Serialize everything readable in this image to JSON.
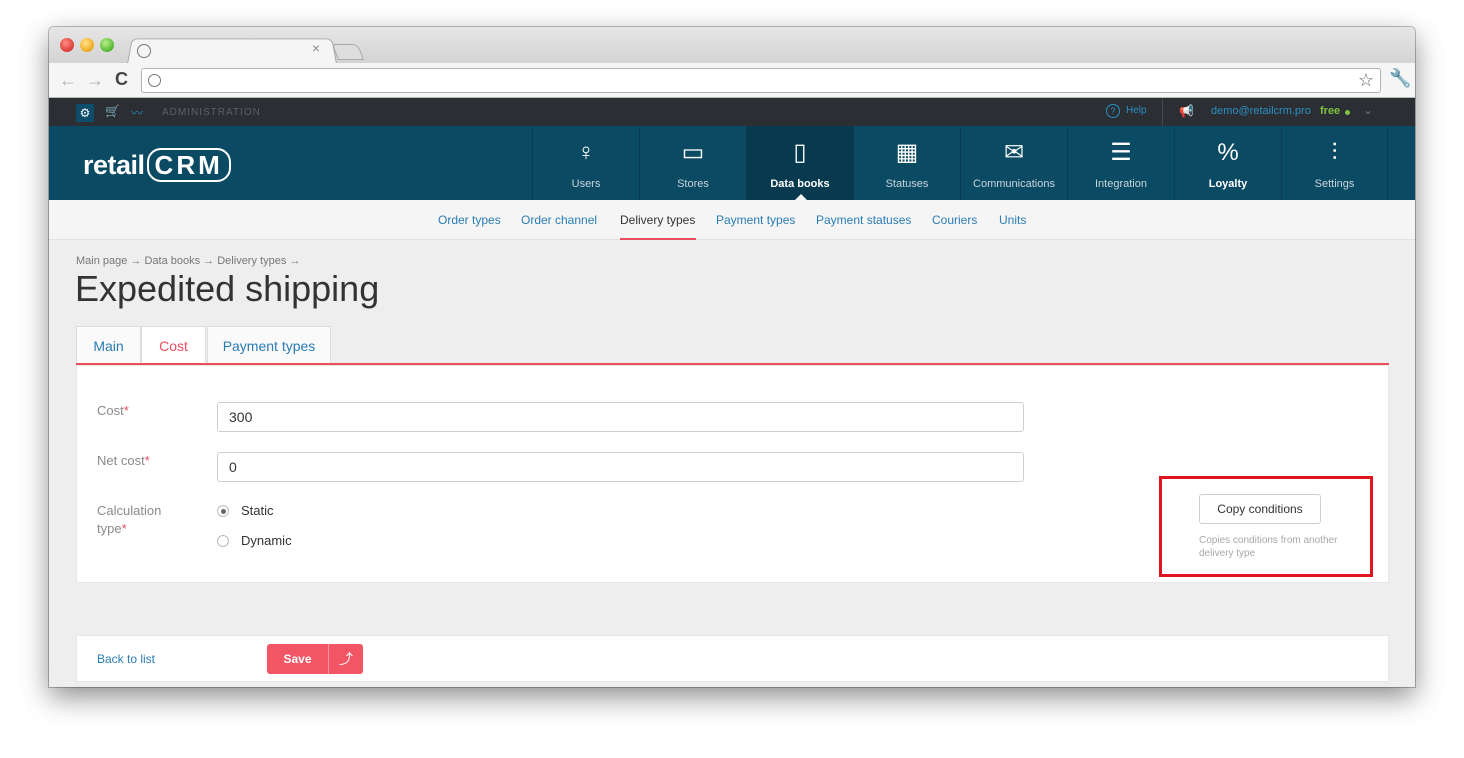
{
  "browser": {
    "tab_close": "×",
    "back_icon": "left-arrow",
    "forward_icon": "right-arrow"
  },
  "topbar": {
    "section_label": "ADMINISTRATION",
    "help": "Help",
    "email": "demo@retailcrm.pro",
    "plan": "free"
  },
  "logo": {
    "text_a": "retail",
    "text_b": "CRM"
  },
  "nav": [
    {
      "label": "Users",
      "icon": "user-icon",
      "glyph": "♀"
    },
    {
      "label": "Stores",
      "icon": "store-icon",
      "glyph": "▭"
    },
    {
      "label": "Data books",
      "icon": "book-icon",
      "glyph": "▯"
    },
    {
      "label": "Statuses",
      "icon": "statuses-icon",
      "glyph": "▦"
    },
    {
      "label": "Communications",
      "icon": "mail-icon",
      "glyph": "✉"
    },
    {
      "label": "Integration",
      "icon": "integration-icon",
      "glyph": "☰"
    },
    {
      "label": "Loyalty",
      "icon": "percent-icon",
      "glyph": "%"
    },
    {
      "label": "Settings",
      "icon": "sliders-icon",
      "glyph": "⫶"
    }
  ],
  "subnav": [
    "Order types",
    "Order channel",
    "Delivery types",
    "Payment types",
    "Payment statuses",
    "Couriers",
    "Units"
  ],
  "breadcrumb": "Main page → Data books → Delivery types →",
  "page_title": "Expedited shipping",
  "tabs": [
    "Main",
    "Cost",
    "Payment types"
  ],
  "form": {
    "cost_label": "Cost",
    "cost_value": "300",
    "net_cost_label": "Net cost",
    "net_cost_value": "0",
    "calc_label_1": "Calculation",
    "calc_label_2": "type",
    "required_mark": "*",
    "option_static": "Static",
    "option_dynamic": "Dynamic",
    "selected": "Static"
  },
  "copy": {
    "button": "Copy conditions",
    "hint": "Copies conditions from another delivery type"
  },
  "footer": {
    "back": "Back to list",
    "save": "Save",
    "save_up": "⤴"
  },
  "colors": {
    "nav_bg": "#0b4a63",
    "accent_red": "#ee4d5d",
    "link_blue": "#2a7cb4",
    "free_green": "#7fc241"
  }
}
